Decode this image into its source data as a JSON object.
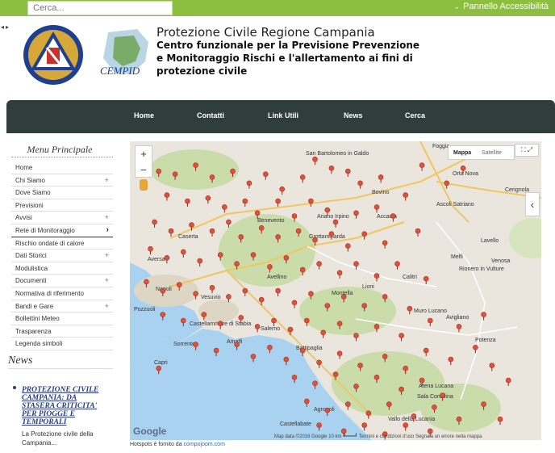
{
  "topbar": {
    "search_placeholder": "Cerca...",
    "accessibility_label": "Pannello Accessibilità"
  },
  "header": {
    "title": "Protezione Civile Regione Campania",
    "subtitle": "Centro funzionale per la Previsione Prevenzione e Monitoraggio Rischi e l'allertamento ai fini di protezione civile",
    "logo2_text": "CEMPID"
  },
  "nav": {
    "items": [
      {
        "label": "Home"
      },
      {
        "label": "Contatti"
      },
      {
        "label": "Link Utili"
      },
      {
        "label": "News"
      },
      {
        "label": "Cerca"
      }
    ]
  },
  "sidebar": {
    "title": "Menu Principale",
    "items": [
      {
        "label": "Home",
        "expand": ""
      },
      {
        "label": "Chi Siamo",
        "expand": "+"
      },
      {
        "label": "Dove Siamo",
        "expand": ""
      },
      {
        "label": "Previsioni",
        "expand": ""
      },
      {
        "label": "Avvisi",
        "expand": "+"
      },
      {
        "label": "Rete di Monitoraggio",
        "expand": "›"
      },
      {
        "label": "Rischio ondate di calore",
        "expand": ""
      },
      {
        "label": "Dati Storici",
        "expand": "+"
      },
      {
        "label": "Modulistica",
        "expand": ""
      },
      {
        "label": "Documenti",
        "expand": "+"
      },
      {
        "label": "Normativa di riferimento",
        "expand": ""
      },
      {
        "label": "Bandi e Gare",
        "expand": "+"
      },
      {
        "label": "Bollettini Meteo",
        "expand": ""
      },
      {
        "label": "Trasparenza",
        "expand": ""
      },
      {
        "label": "Legenda simboli",
        "expand": ""
      }
    ]
  },
  "news": {
    "title": "News",
    "headline": "PROTEZIONE CIVILE CAMPANIA: DA STASERA CRITICITA' PER PIOGGE E TEMPORALI",
    "excerpt": "La Protezione civile della Campania..."
  },
  "map": {
    "type_map": "Mappa",
    "type_satellite": "Satellite",
    "zoom_in": "+",
    "zoom_out": "−",
    "google_logo": "Google",
    "footer": "Map data ©2016 Google   10 km ┗━━━┛   Termini e condizioni d'uso   Segnala un errore nella mappa",
    "credit_text": "Hotspots è fornito da",
    "credit_link": "compojoom.com",
    "places": [
      {
        "name": "Foggia"
      },
      {
        "name": "San Bartolomeo in Galdo"
      },
      {
        "name": "Orta Nova"
      },
      {
        "name": "Cerignola"
      },
      {
        "name": "Bovino"
      },
      {
        "name": "Ascoli Satriano"
      },
      {
        "name": "Benevento"
      },
      {
        "name": "Ariano Irpino"
      },
      {
        "name": "Accadia"
      },
      {
        "name": "Caserta"
      },
      {
        "name": "Grottaminarda"
      },
      {
        "name": "Lavello"
      },
      {
        "name": "Aversa"
      },
      {
        "name": "Melfi"
      },
      {
        "name": "Venosa"
      },
      {
        "name": "Avellino"
      },
      {
        "name": "Rionero in Vulture"
      },
      {
        "name": "Napoli"
      },
      {
        "name": "Vesuvio"
      },
      {
        "name": "Calitri"
      },
      {
        "name": "Lioni"
      },
      {
        "name": "Pozzuoli"
      },
      {
        "name": "Montella"
      },
      {
        "name": "Castellammare di Stabia"
      },
      {
        "name": "Salerno"
      },
      {
        "name": "Muro Lucano"
      },
      {
        "name": "Avigliano"
      },
      {
        "name": "Sorrento"
      },
      {
        "name": "Amalfi"
      },
      {
        "name": "Battipaglia"
      },
      {
        "name": "Potenza"
      },
      {
        "name": "Capri"
      },
      {
        "name": "Atena Lucana"
      },
      {
        "name": "Sala Consilina"
      },
      {
        "name": "Agropoli"
      },
      {
        "name": "Vallo della Lucania"
      },
      {
        "name": "Castellabate"
      }
    ],
    "markers": [
      [
        0.07,
        0.1
      ],
      [
        0.11,
        0.11
      ],
      [
        0.16,
        0.08
      ],
      [
        0.2,
        0.12
      ],
      [
        0.25,
        0.1
      ],
      [
        0.29,
        0.14
      ],
      [
        0.33,
        0.11
      ],
      [
        0.37,
        0.16
      ],
      [
        0.42,
        0.12
      ],
      [
        0.45,
        0.06
      ],
      [
        0.49,
        0.09
      ],
      [
        0.53,
        0.1
      ],
      [
        0.56,
        0.14
      ],
      [
        0.61,
        0.12
      ],
      [
        0.67,
        0.18
      ],
      [
        0.71,
        0.08
      ],
      [
        0.77,
        0.14
      ],
      [
        0.81,
        0.09
      ],
      [
        0.09,
        0.18
      ],
      [
        0.14,
        0.2
      ],
      [
        0.19,
        0.19
      ],
      [
        0.23,
        0.22
      ],
      [
        0.28,
        0.2
      ],
      [
        0.31,
        0.24
      ],
      [
        0.36,
        0.2
      ],
      [
        0.4,
        0.25
      ],
      [
        0.44,
        0.2
      ],
      [
        0.48,
        0.23
      ],
      [
        0.5,
        0.27
      ],
      [
        0.55,
        0.24
      ],
      [
        0.6,
        0.22
      ],
      [
        0.64,
        0.25
      ],
      [
        0.06,
        0.27
      ],
      [
        0.1,
        0.3
      ],
      [
        0.15,
        0.28
      ],
      [
        0.2,
        0.3
      ],
      [
        0.24,
        0.27
      ],
      [
        0.27,
        0.32
      ],
      [
        0.32,
        0.29
      ],
      [
        0.36,
        0.32
      ],
      [
        0.41,
        0.3
      ],
      [
        0.45,
        0.33
      ],
      [
        0.49,
        0.31
      ],
      [
        0.53,
        0.35
      ],
      [
        0.57,
        0.31
      ],
      [
        0.62,
        0.34
      ],
      [
        0.7,
        0.3
      ],
      [
        0.05,
        0.36
      ],
      [
        0.09,
        0.39
      ],
      [
        0.13,
        0.37
      ],
      [
        0.17,
        0.4
      ],
      [
        0.22,
        0.38
      ],
      [
        0.26,
        0.41
      ],
      [
        0.3,
        0.38
      ],
      [
        0.34,
        0.42
      ],
      [
        0.38,
        0.39
      ],
      [
        0.42,
        0.43
      ],
      [
        0.46,
        0.41
      ],
      [
        0.51,
        0.44
      ],
      [
        0.55,
        0.41
      ],
      [
        0.6,
        0.45
      ],
      [
        0.65,
        0.41
      ],
      [
        0.72,
        0.46
      ],
      [
        0.04,
        0.47
      ],
      [
        0.08,
        0.5
      ],
      [
        0.12,
        0.48
      ],
      [
        0.16,
        0.51
      ],
      [
        0.2,
        0.49
      ],
      [
        0.24,
        0.52
      ],
      [
        0.28,
        0.5
      ],
      [
        0.32,
        0.53
      ],
      [
        0.36,
        0.5
      ],
      [
        0.4,
        0.54
      ],
      [
        0.44,
        0.51
      ],
      [
        0.48,
        0.55
      ],
      [
        0.52,
        0.52
      ],
      [
        0.57,
        0.55
      ],
      [
        0.62,
        0.52
      ],
      [
        0.68,
        0.56
      ],
      [
        0.08,
        0.58
      ],
      [
        0.13,
        0.6
      ],
      [
        0.18,
        0.58
      ],
      [
        0.22,
        0.61
      ],
      [
        0.27,
        0.59
      ],
      [
        0.31,
        0.62
      ],
      [
        0.35,
        0.6
      ],
      [
        0.39,
        0.63
      ],
      [
        0.43,
        0.6
      ],
      [
        0.47,
        0.64
      ],
      [
        0.51,
        0.61
      ],
      [
        0.55,
        0.65
      ],
      [
        0.6,
        0.62
      ],
      [
        0.66,
        0.65
      ],
      [
        0.73,
        0.6
      ],
      [
        0.8,
        0.62
      ],
      [
        0.86,
        0.58
      ],
      [
        0.16,
        0.68
      ],
      [
        0.21,
        0.7
      ],
      [
        0.26,
        0.68
      ],
      [
        0.3,
        0.72
      ],
      [
        0.34,
        0.69
      ],
      [
        0.38,
        0.73
      ],
      [
        0.42,
        0.7
      ],
      [
        0.46,
        0.74
      ],
      [
        0.51,
        0.71
      ],
      [
        0.56,
        0.75
      ],
      [
        0.62,
        0.72
      ],
      [
        0.67,
        0.76
      ],
      [
        0.72,
        0.7
      ],
      [
        0.78,
        0.73
      ],
      [
        0.84,
        0.69
      ],
      [
        0.07,
        0.76
      ],
      [
        0.4,
        0.79
      ],
      [
        0.45,
        0.81
      ],
      [
        0.5,
        0.78
      ],
      [
        0.55,
        0.82
      ],
      [
        0.6,
        0.79
      ],
      [
        0.66,
        0.83
      ],
      [
        0.71,
        0.8
      ],
      [
        0.76,
        0.85
      ],
      [
        0.43,
        0.87
      ],
      [
        0.48,
        0.9
      ],
      [
        0.53,
        0.88
      ],
      [
        0.58,
        0.91
      ],
      [
        0.63,
        0.88
      ],
      [
        0.69,
        0.92
      ],
      [
        0.74,
        0.89
      ],
      [
        0.8,
        0.93
      ],
      [
        0.46,
        0.95
      ],
      [
        0.52,
        0.97
      ],
      [
        0.57,
        0.95
      ],
      [
        0.62,
        0.98
      ],
      [
        0.67,
        0.95
      ],
      [
        0.73,
        0.97
      ],
      [
        0.88,
        0.75
      ],
      [
        0.92,
        0.8
      ],
      [
        0.86,
        0.88
      ],
      [
        0.9,
        0.93
      ]
    ]
  }
}
